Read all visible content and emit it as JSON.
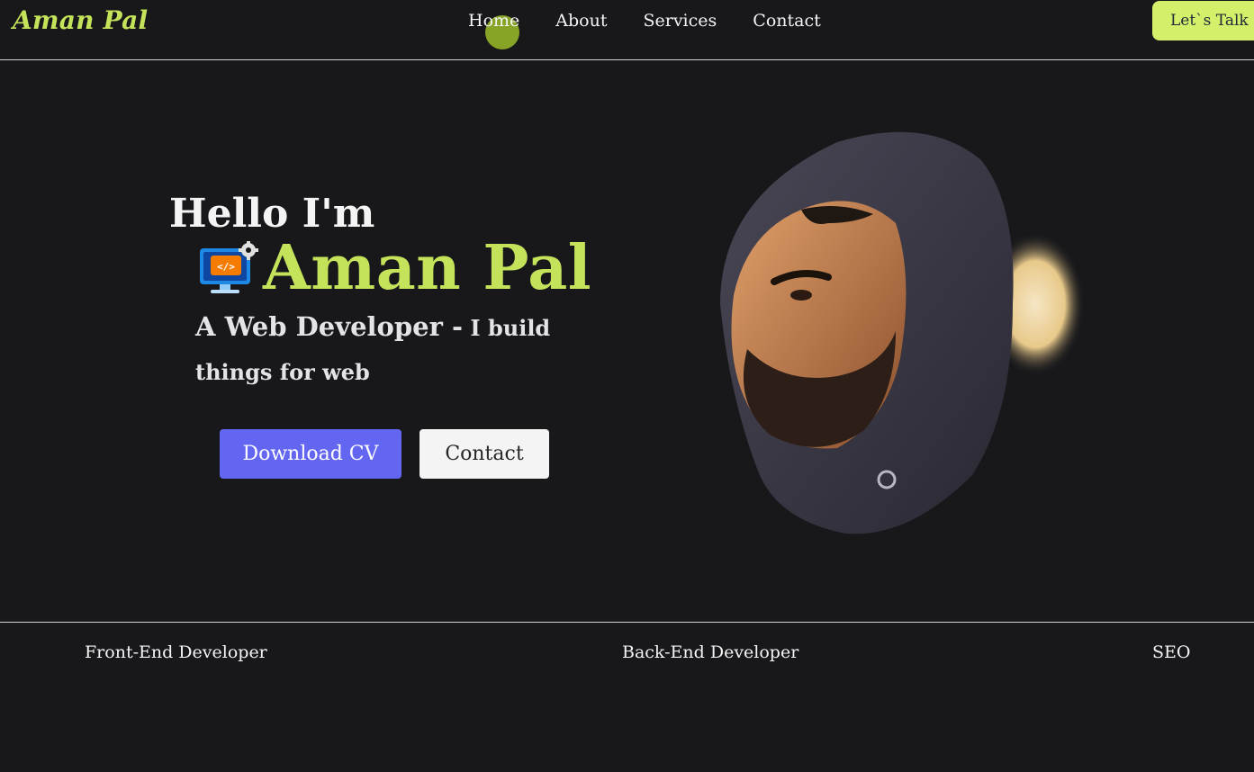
{
  "header": {
    "brand": "Aman Pal",
    "nav": [
      "Home",
      "About",
      "Services",
      "Contact"
    ],
    "cta": "Let`s Talk"
  },
  "hero": {
    "greeting": "Hello I'm",
    "name": "Aman Pal",
    "role": "A Web Developer -",
    "tagline_rest": " I build things for web",
    "buttons": {
      "download": "Download CV",
      "contact": "Contact"
    },
    "dev_icon_text": "</>"
  },
  "skills": [
    "Front-End Developer",
    "Back-End Developer",
    "SEO"
  ],
  "colors": {
    "background": "#18181b",
    "accent": "#c5e35a",
    "cta_bg": "#d4ef6a",
    "primary_button": "#6366f1",
    "nav_dot": "#9bbd29"
  },
  "icons": [
    "developer-monitor-icon",
    "gear-icon"
  ]
}
